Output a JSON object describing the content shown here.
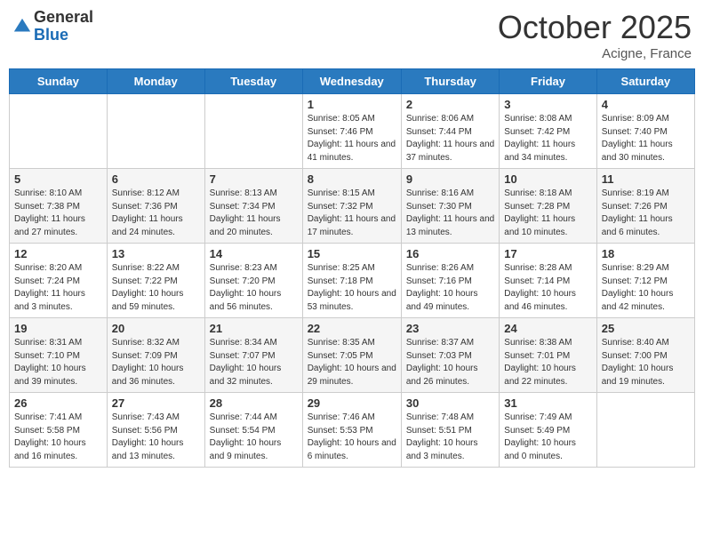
{
  "header": {
    "logo_general": "General",
    "logo_blue": "Blue",
    "month_title": "October 2025",
    "location": "Acigne, France"
  },
  "days_of_week": [
    "Sunday",
    "Monday",
    "Tuesday",
    "Wednesday",
    "Thursday",
    "Friday",
    "Saturday"
  ],
  "weeks": [
    [
      {
        "day": "",
        "info": ""
      },
      {
        "day": "",
        "info": ""
      },
      {
        "day": "",
        "info": ""
      },
      {
        "day": "1",
        "info": "Sunrise: 8:05 AM\nSunset: 7:46 PM\nDaylight: 11 hours and 41 minutes."
      },
      {
        "day": "2",
        "info": "Sunrise: 8:06 AM\nSunset: 7:44 PM\nDaylight: 11 hours and 37 minutes."
      },
      {
        "day": "3",
        "info": "Sunrise: 8:08 AM\nSunset: 7:42 PM\nDaylight: 11 hours and 34 minutes."
      },
      {
        "day": "4",
        "info": "Sunrise: 8:09 AM\nSunset: 7:40 PM\nDaylight: 11 hours and 30 minutes."
      }
    ],
    [
      {
        "day": "5",
        "info": "Sunrise: 8:10 AM\nSunset: 7:38 PM\nDaylight: 11 hours and 27 minutes."
      },
      {
        "day": "6",
        "info": "Sunrise: 8:12 AM\nSunset: 7:36 PM\nDaylight: 11 hours and 24 minutes."
      },
      {
        "day": "7",
        "info": "Sunrise: 8:13 AM\nSunset: 7:34 PM\nDaylight: 11 hours and 20 minutes."
      },
      {
        "day": "8",
        "info": "Sunrise: 8:15 AM\nSunset: 7:32 PM\nDaylight: 11 hours and 17 minutes."
      },
      {
        "day": "9",
        "info": "Sunrise: 8:16 AM\nSunset: 7:30 PM\nDaylight: 11 hours and 13 minutes."
      },
      {
        "day": "10",
        "info": "Sunrise: 8:18 AM\nSunset: 7:28 PM\nDaylight: 11 hours and 10 minutes."
      },
      {
        "day": "11",
        "info": "Sunrise: 8:19 AM\nSunset: 7:26 PM\nDaylight: 11 hours and 6 minutes."
      }
    ],
    [
      {
        "day": "12",
        "info": "Sunrise: 8:20 AM\nSunset: 7:24 PM\nDaylight: 11 hours and 3 minutes."
      },
      {
        "day": "13",
        "info": "Sunrise: 8:22 AM\nSunset: 7:22 PM\nDaylight: 10 hours and 59 minutes."
      },
      {
        "day": "14",
        "info": "Sunrise: 8:23 AM\nSunset: 7:20 PM\nDaylight: 10 hours and 56 minutes."
      },
      {
        "day": "15",
        "info": "Sunrise: 8:25 AM\nSunset: 7:18 PM\nDaylight: 10 hours and 53 minutes."
      },
      {
        "day": "16",
        "info": "Sunrise: 8:26 AM\nSunset: 7:16 PM\nDaylight: 10 hours and 49 minutes."
      },
      {
        "day": "17",
        "info": "Sunrise: 8:28 AM\nSunset: 7:14 PM\nDaylight: 10 hours and 46 minutes."
      },
      {
        "day": "18",
        "info": "Sunrise: 8:29 AM\nSunset: 7:12 PM\nDaylight: 10 hours and 42 minutes."
      }
    ],
    [
      {
        "day": "19",
        "info": "Sunrise: 8:31 AM\nSunset: 7:10 PM\nDaylight: 10 hours and 39 minutes."
      },
      {
        "day": "20",
        "info": "Sunrise: 8:32 AM\nSunset: 7:09 PM\nDaylight: 10 hours and 36 minutes."
      },
      {
        "day": "21",
        "info": "Sunrise: 8:34 AM\nSunset: 7:07 PM\nDaylight: 10 hours and 32 minutes."
      },
      {
        "day": "22",
        "info": "Sunrise: 8:35 AM\nSunset: 7:05 PM\nDaylight: 10 hours and 29 minutes."
      },
      {
        "day": "23",
        "info": "Sunrise: 8:37 AM\nSunset: 7:03 PM\nDaylight: 10 hours and 26 minutes."
      },
      {
        "day": "24",
        "info": "Sunrise: 8:38 AM\nSunset: 7:01 PM\nDaylight: 10 hours and 22 minutes."
      },
      {
        "day": "25",
        "info": "Sunrise: 8:40 AM\nSunset: 7:00 PM\nDaylight: 10 hours and 19 minutes."
      }
    ],
    [
      {
        "day": "26",
        "info": "Sunrise: 7:41 AM\nSunset: 5:58 PM\nDaylight: 10 hours and 16 minutes."
      },
      {
        "day": "27",
        "info": "Sunrise: 7:43 AM\nSunset: 5:56 PM\nDaylight: 10 hours and 13 minutes."
      },
      {
        "day": "28",
        "info": "Sunrise: 7:44 AM\nSunset: 5:54 PM\nDaylight: 10 hours and 9 minutes."
      },
      {
        "day": "29",
        "info": "Sunrise: 7:46 AM\nSunset: 5:53 PM\nDaylight: 10 hours and 6 minutes."
      },
      {
        "day": "30",
        "info": "Sunrise: 7:48 AM\nSunset: 5:51 PM\nDaylight: 10 hours and 3 minutes."
      },
      {
        "day": "31",
        "info": "Sunrise: 7:49 AM\nSunset: 5:49 PM\nDaylight: 10 hours and 0 minutes."
      },
      {
        "day": "",
        "info": ""
      }
    ]
  ]
}
